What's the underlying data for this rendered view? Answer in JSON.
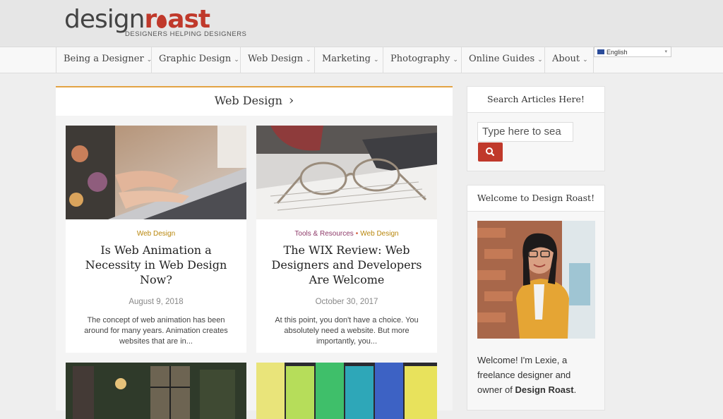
{
  "header": {
    "logo_part1": "design",
    "logo_part2": "ast",
    "logo_r": "r",
    "tagline": "DESIGNERS HELPING DESIGNERS"
  },
  "nav": {
    "items": [
      {
        "label": "Being a Designer"
      },
      {
        "label": "Graphic Design"
      },
      {
        "label": "Web Design"
      },
      {
        "label": "Marketing"
      },
      {
        "label": "Photography"
      },
      {
        "label": "Online Guides"
      },
      {
        "label": "About"
      }
    ],
    "chevron": "⌄"
  },
  "language": {
    "selected": "English",
    "caret": "▾"
  },
  "section": {
    "title": "Web Design",
    "arrow": "›"
  },
  "posts": [
    {
      "categories": [
        "Web Design"
      ],
      "title": "Is Web Animation a Necessity in Web Design Now?",
      "date": "August 9, 2018",
      "excerpt": "The concept of web animation has been around for many years. Animation creates websites that are in..."
    },
    {
      "categories": [
        "Tools & Resources",
        "Web Design"
      ],
      "separator": "•",
      "title": "The WIX Review: Web Designers and Developers Are Welcome",
      "date": "October 30, 2017",
      "excerpt": "At this point, you don't have a choice. You absolutely need a website. But more importantly, you..."
    }
  ],
  "sidebar": {
    "search_title": "Search Articles Here!",
    "search_placeholder": "Type here to sea",
    "welcome_title": "Welcome to Design Roast!",
    "welcome_text_1": "Welcome! I'm Lexie, a freelance designer and owner of ",
    "welcome_text_bold": "Design Roast",
    "welcome_text_2": "."
  },
  "colors": {
    "accent": "#c0392b",
    "section_border": "#e3a343",
    "category_gold": "#b8860b",
    "category_purple": "#8e3a69"
  },
  "icons": {
    "search": "search-icon",
    "dropdown": "chevron-down-icon"
  }
}
